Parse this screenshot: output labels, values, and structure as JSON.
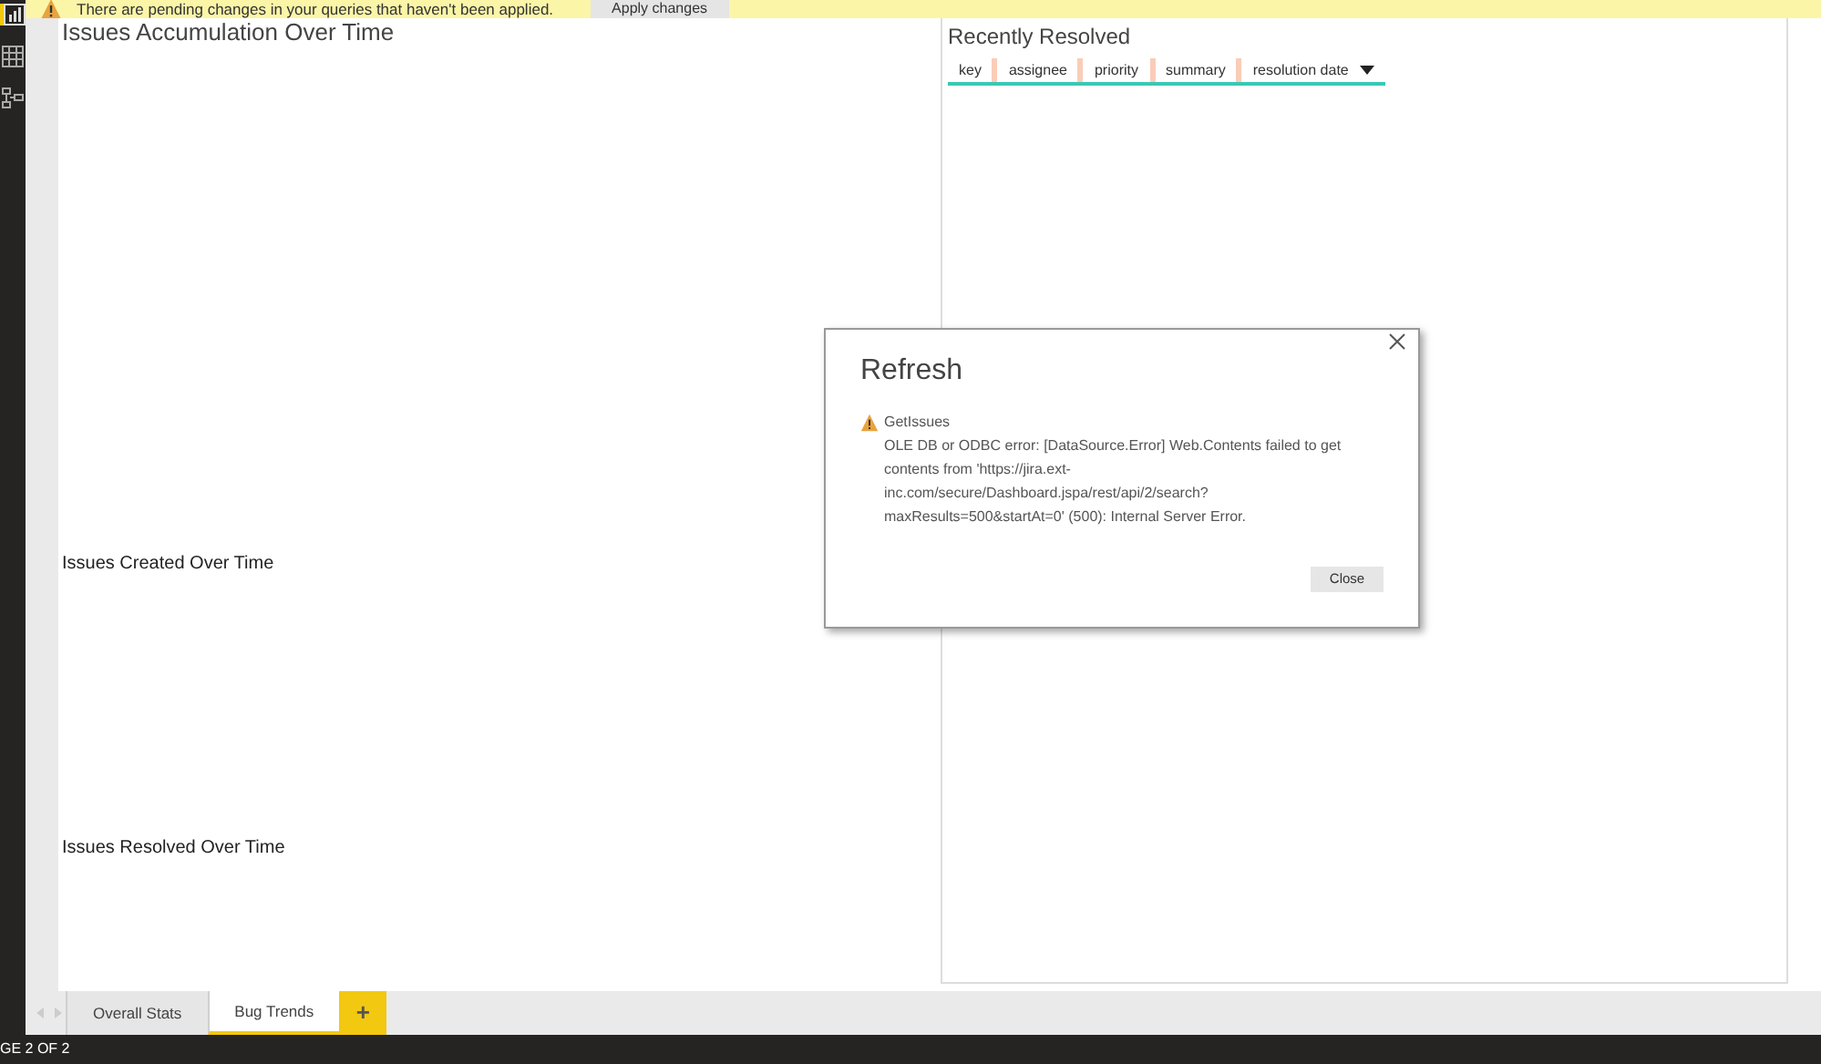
{
  "notification": {
    "message": "There are pending changes in your queries that haven't been applied.",
    "button": "Apply changes"
  },
  "sidebar": {
    "items": [
      {
        "kind": "report",
        "selected": true
      },
      {
        "kind": "data",
        "selected": false
      },
      {
        "kind": "model",
        "selected": false
      }
    ]
  },
  "visuals": [
    {
      "title": "Issues Accumulation Over Time",
      "kind": "large"
    },
    {
      "title": "Issues Created Over Time",
      "kind": "small"
    },
    {
      "title": "Issues Resolved Over Time",
      "kind": "small"
    }
  ],
  "recently_resolved": {
    "title": "Recently Resolved",
    "columns": [
      {
        "label": "key",
        "sorted": false
      },
      {
        "label": "assignee",
        "sorted": false
      },
      {
        "label": "priority",
        "sorted": false
      },
      {
        "label": "summary",
        "sorted": false
      },
      {
        "label": "resolution date",
        "sorted": true
      }
    ]
  },
  "dialog": {
    "title": "Refresh",
    "query": "GetIssues",
    "message": "OLE DB or ODBC error: [DataSource.Error] Web.Contents failed to get contents from 'https://jira.ext-inc.com/secure/Dashboard.jspa/rest/api/2/search?maxResults=500&startAt=0' (500): Internal Server Error.",
    "button": "Close"
  },
  "page_tabs": [
    {
      "label": "Overall Stats",
      "selected": false
    },
    {
      "label": "Bug Trends",
      "selected": true
    }
  ],
  "add_tab": "+",
  "status_bar": "GE 2 OF 2"
}
